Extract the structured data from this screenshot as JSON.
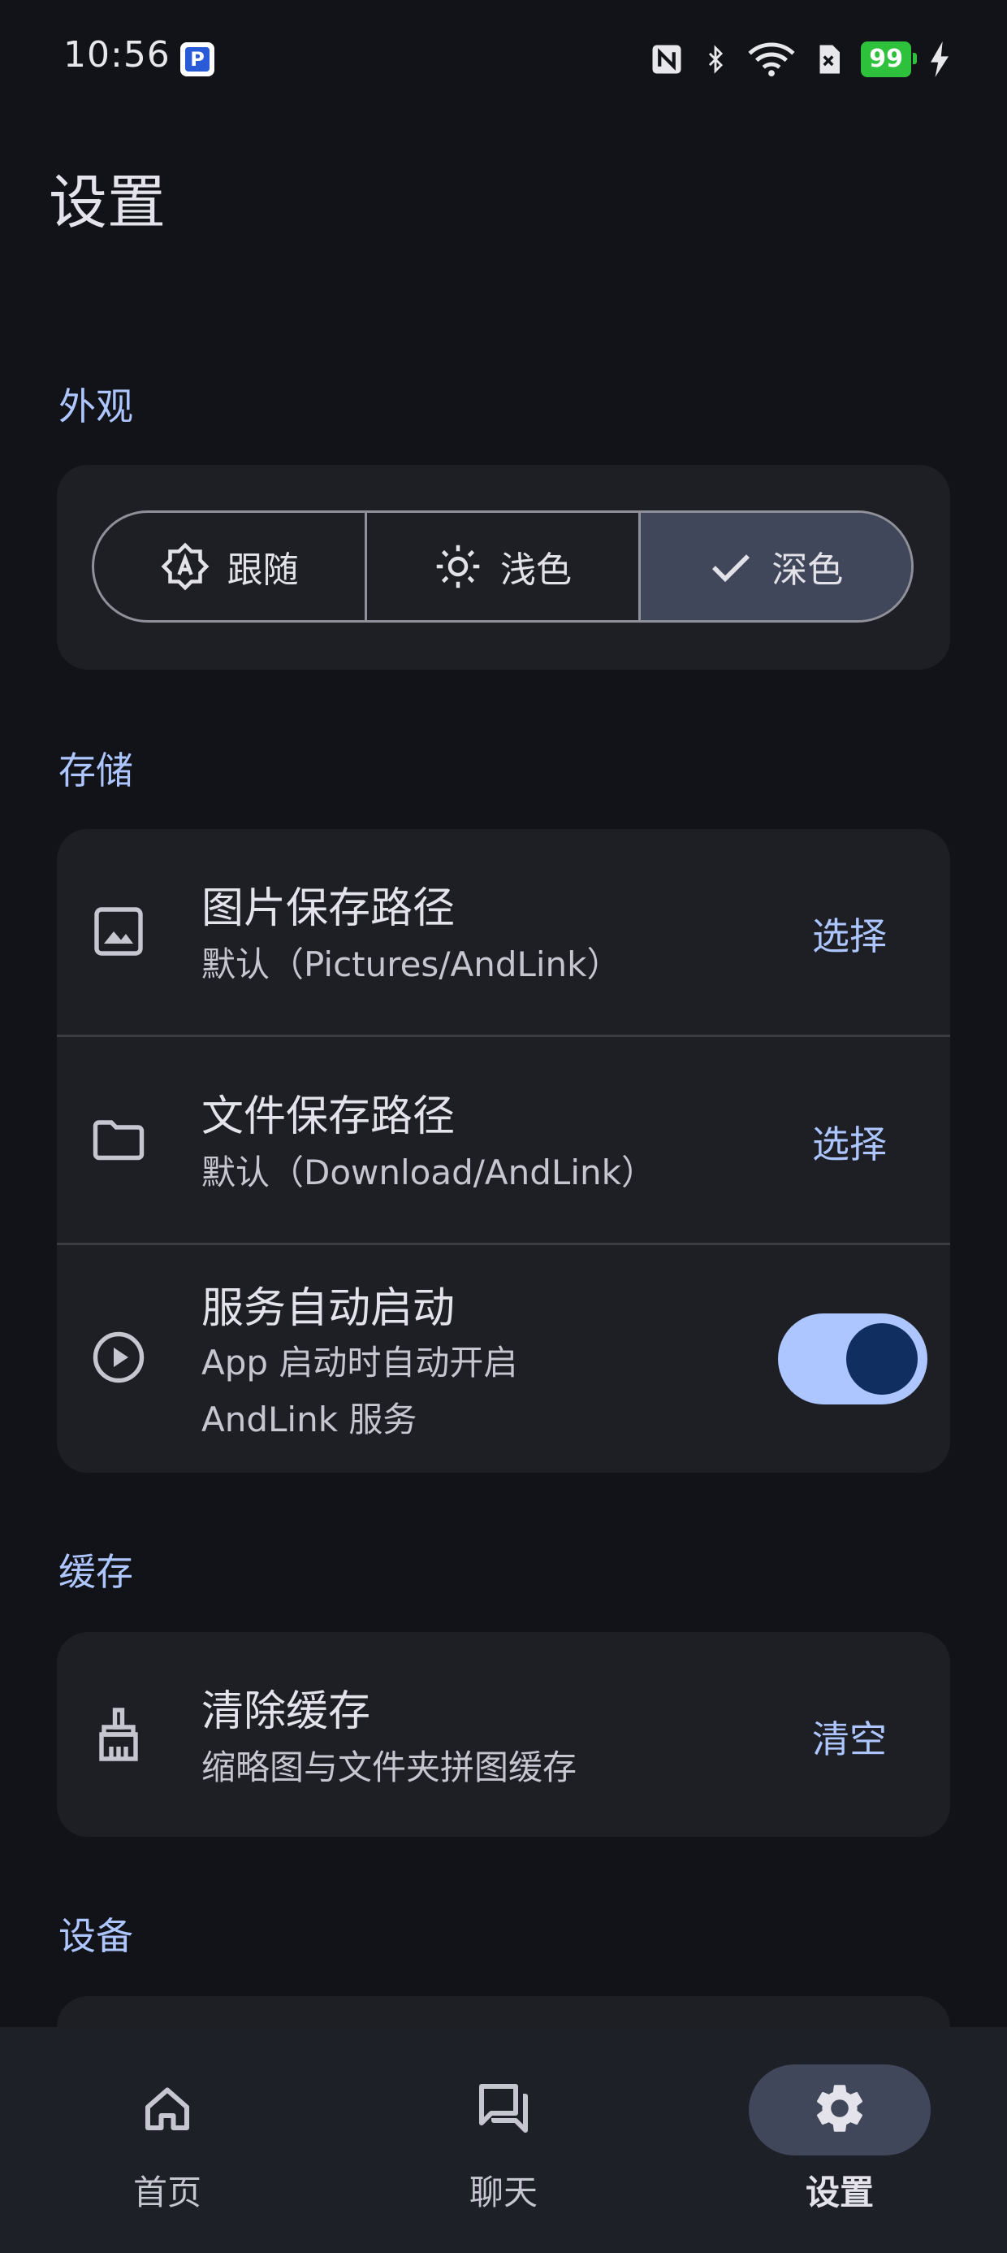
{
  "status_bar": {
    "time": "10:56",
    "app_icon_letter": "P",
    "battery": "99"
  },
  "page": {
    "title": "设置"
  },
  "appearance": {
    "section_label": "外观",
    "options": [
      {
        "label": "跟随",
        "icon": "brightness-auto-icon",
        "selected": false
      },
      {
        "label": "浅色",
        "icon": "sun-icon",
        "selected": false
      },
      {
        "label": "深色",
        "icon": "check-icon",
        "selected": true
      }
    ]
  },
  "storage": {
    "section_label": "存储",
    "image_path": {
      "title": "图片保存路径",
      "subtitle": "默认（Pictures/AndLink）",
      "action": "选择"
    },
    "file_path": {
      "title": "文件保存路径",
      "subtitle": "默认（Download/AndLink）",
      "action": "选择"
    },
    "auto_start": {
      "title": "服务自动启动",
      "subtitle_line1": "App 启动时自动开启",
      "subtitle_line2": "AndLink 服务",
      "enabled": true
    }
  },
  "cache": {
    "section_label": "缓存",
    "clear": {
      "title": "清除缓存",
      "subtitle": "缩略图与文件夹拼图缓存",
      "action": "清空"
    }
  },
  "device": {
    "section_label": "设备"
  },
  "bottom_nav": {
    "items": [
      {
        "label": "首页",
        "icon": "home-icon",
        "active": false
      },
      {
        "label": "聊天",
        "icon": "chat-icon",
        "active": false
      },
      {
        "label": "设置",
        "icon": "gear-icon",
        "active": true
      }
    ]
  },
  "colors": {
    "background": "#121318",
    "card": "#1d1f25",
    "accent": "#adc6ff",
    "selected": "#41475a",
    "toggle_knob": "#102f60"
  }
}
